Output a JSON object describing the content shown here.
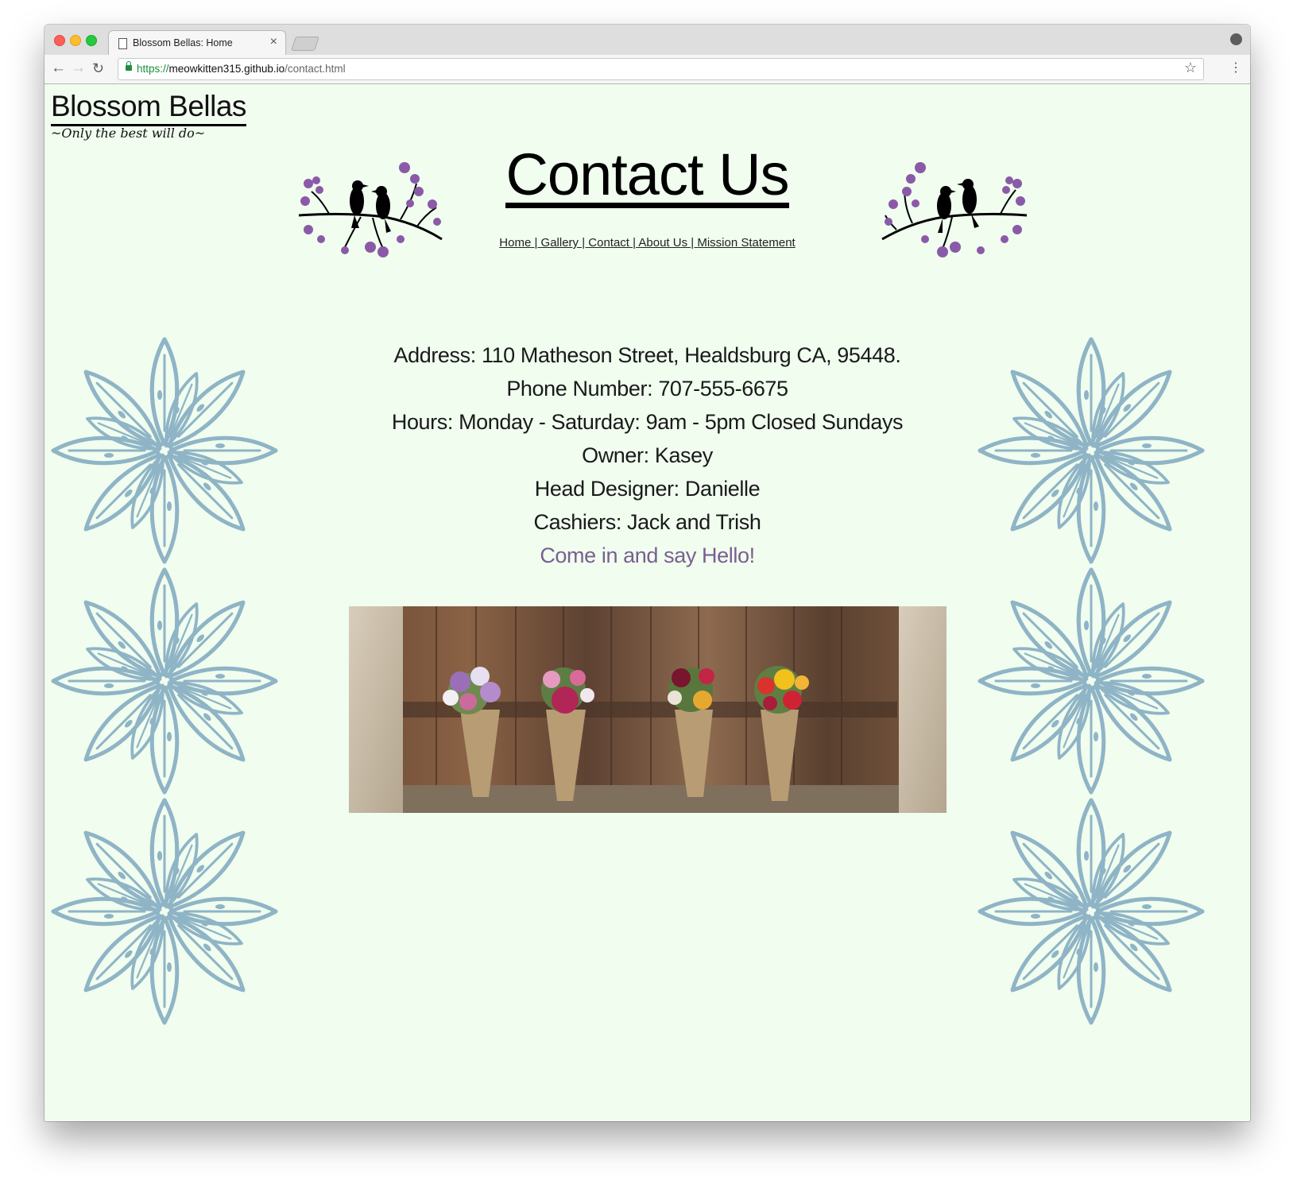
{
  "browser": {
    "tab_title": "Blossom Bellas: Home",
    "tab_close": "×",
    "url_scheme": "https://",
    "url_host": "meowkitten315.github.io",
    "url_path": "/contact.html",
    "back_icon": "←",
    "forward_icon": "→",
    "reload_icon": "↻",
    "star_icon": "☆",
    "menu_icon": "⋮"
  },
  "site": {
    "brand": "Blossom Bellas",
    "tagline": "~Only the best will do~"
  },
  "header": {
    "title": "Contact Us",
    "nav": [
      {
        "label": "Home"
      },
      {
        "label": "Gallery"
      },
      {
        "label": "Contact"
      },
      {
        "label": "About Us"
      },
      {
        "label": "Mission Statement"
      }
    ],
    "separator": " | "
  },
  "contact": {
    "address": "Address: 110 Matheson Street, Healdsburg CA, 95448.",
    "phone": "Phone Number: 707-555-6675",
    "hours": "Hours: Monday - Saturday: 9am - 5pm Closed Sundays",
    "owner": "Owner: Kasey",
    "head_designer": "Head Designer: Danielle",
    "cashiers": "Cashiers: Jack and Trish",
    "greeting": "Come in and say Hello!"
  },
  "colors": {
    "page_background": "#f0fdef",
    "lily_stroke": "#8fb4c6",
    "blossom": "#8a5aa8",
    "greeting": "#7a5f90"
  },
  "icons": {
    "decoration_left": "birds-on-branch-icon",
    "decoration_right": "birds-on-branch-icon",
    "side_art": "lily-flower-icon"
  }
}
